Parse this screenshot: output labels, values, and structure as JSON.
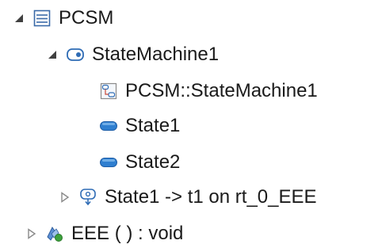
{
  "tree": {
    "root": {
      "label": "PCSM",
      "expanded": true,
      "icon": "package-icon"
    },
    "state_machine": {
      "label": "StateMachine1",
      "expanded": true,
      "icon": "state-machine-icon"
    },
    "diagram": {
      "label": "PCSM::StateMachine1",
      "icon": "diagram-icon"
    },
    "states": [
      {
        "label": "State1",
        "icon": "state-icon"
      },
      {
        "label": "State2",
        "icon": "state-icon"
      }
    ],
    "transition": {
      "label": "State1 -> t1 on rt_0_EEE",
      "expanded": false,
      "icon": "transition-icon"
    },
    "operation": {
      "label": "EEE ( ) : void",
      "expanded": false,
      "icon": "operation-icon"
    }
  },
  "colors": {
    "state_fill": "#2f7fd0",
    "state_stroke": "#1f5fa8",
    "toggle_expanded": "#404040",
    "toggle_collapsed": "#8a8a8a",
    "operation_green": "#3da13d"
  }
}
